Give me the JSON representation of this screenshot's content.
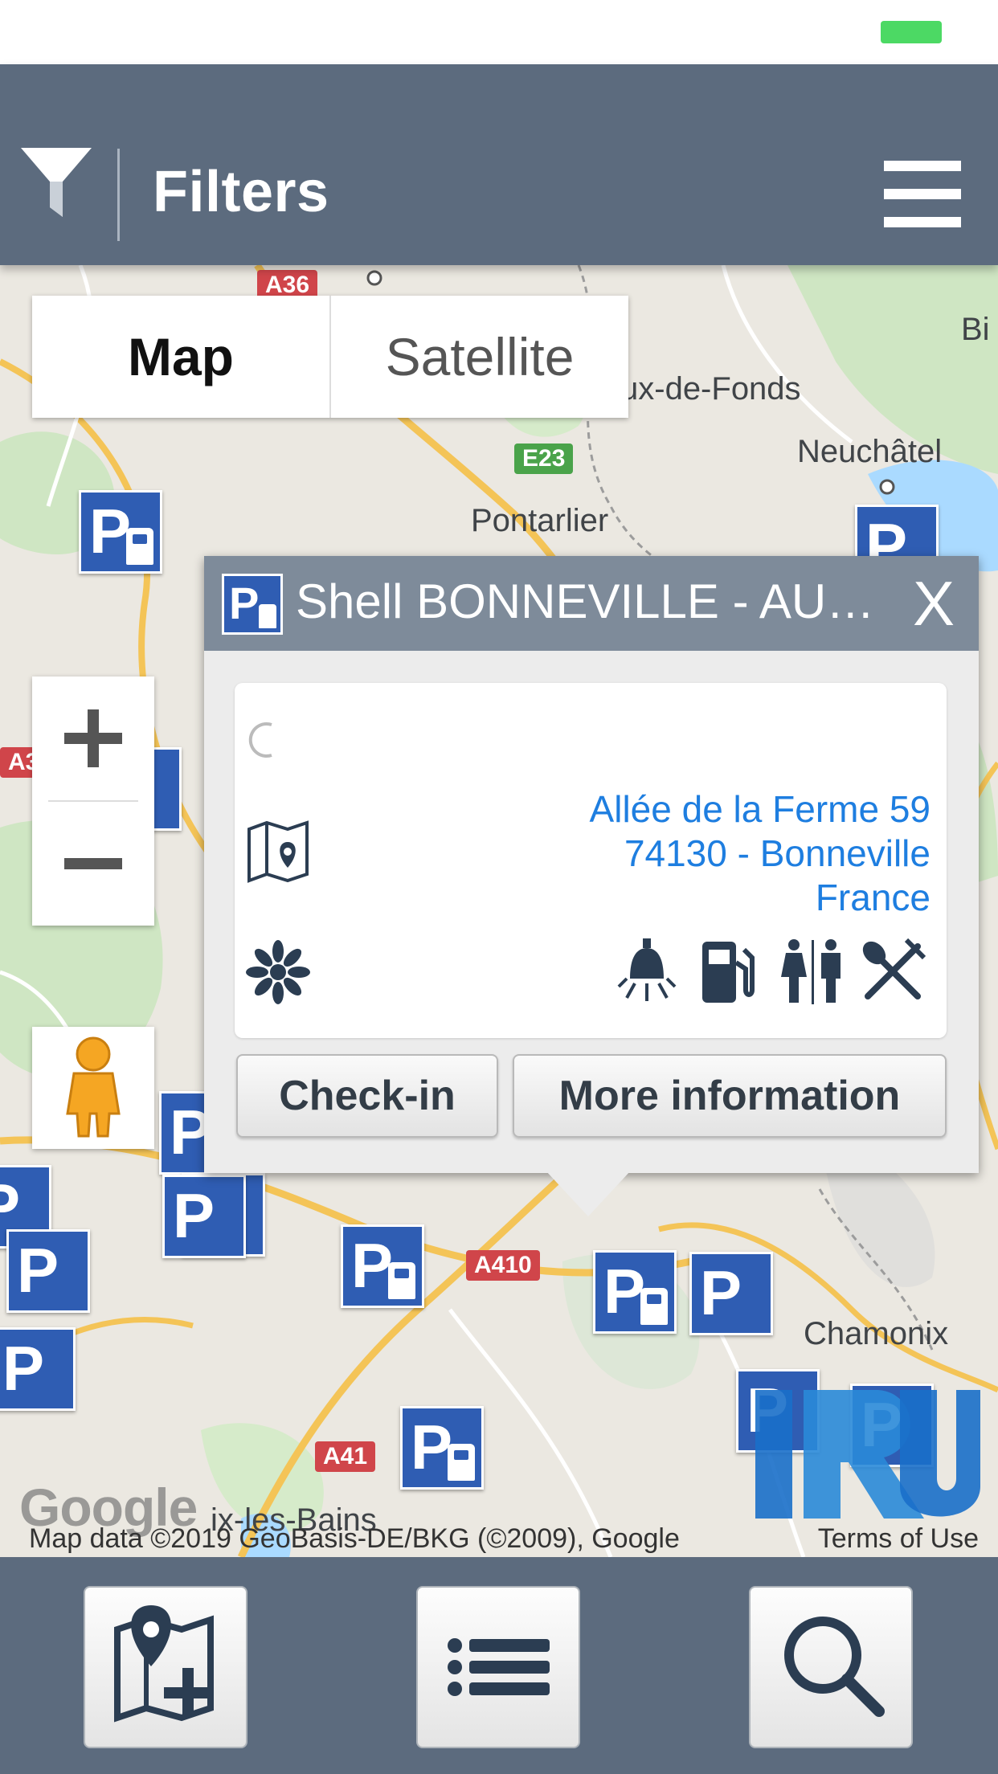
{
  "header": {
    "title": "Filters"
  },
  "map_type": {
    "options": [
      "Map",
      "Satellite"
    ],
    "selected": "Map"
  },
  "map_labels": {
    "cities": [
      "Pontarlier",
      "Neuchâtel",
      "ux-de-Fonds",
      "Chamonix",
      "ix-les-Bains",
      "Bi"
    ],
    "roads": [
      "A36",
      "E23",
      "A410",
      "A41",
      "A3"
    ]
  },
  "popup": {
    "title": "Shell BONNEVILLE - AUT ...",
    "close_label": "X",
    "address": {
      "line1": "Allée de la Ferme 59",
      "line2": "74130 - Bonneville",
      "line3": "France"
    },
    "services": [
      "light-icon",
      "fuel-pump-icon",
      "toilets-icon",
      "restaurant-icon"
    ],
    "checkin_label": "Check-in",
    "more_info_label": "More information"
  },
  "attribution": {
    "map_data": "Map data ©2019 GeoBasis-DE/BKG (©2009), Google",
    "terms": "Terms of Use",
    "logo": "Google"
  },
  "colors": {
    "header": "#5c6b7e",
    "marker": "#2f5db3",
    "link": "#1e7ee0",
    "popup_header": "#7e8b9a"
  }
}
